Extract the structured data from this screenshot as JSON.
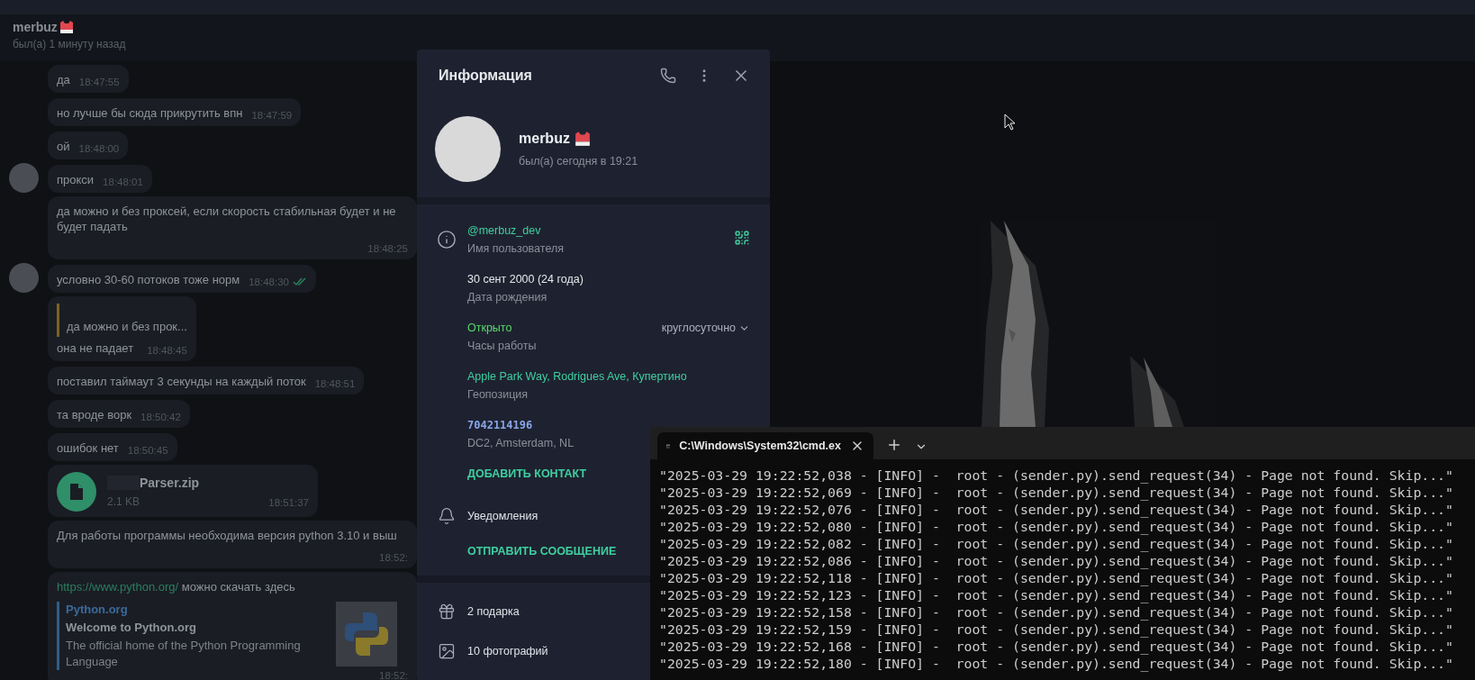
{
  "chat_header": {
    "name": "merbuz",
    "status": "был(а) 1 минуту назад"
  },
  "messages": [
    {
      "kind": "text",
      "text": "да",
      "time": "18:47:55",
      "avatar": false
    },
    {
      "kind": "text",
      "text": "но лучше бы сюда прикрутить впн",
      "time": "18:47:59",
      "avatar": false
    },
    {
      "kind": "text",
      "text": "ой",
      "time": "18:48:00",
      "avatar": false
    },
    {
      "kind": "text",
      "text": "прокси",
      "time": "18:48:01",
      "avatar": true
    },
    {
      "kind": "text",
      "text": "да можно и без проксей, если скорость стабильная будет и не будет падать",
      "time": "18:48:25",
      "avatar": false
    },
    {
      "kind": "text",
      "text": "условно 30-60 потоков тоже норм",
      "time": "18:48:30",
      "avatar": true,
      "read": true
    },
    {
      "kind": "reply",
      "quote": "да можно и без прок...",
      "text": "она не падает",
      "time": "18:48:45",
      "avatar": false
    },
    {
      "kind": "text",
      "text": "поставил таймаут 3 секунды на каждый поток",
      "time": "18:48:51",
      "avatar": false
    },
    {
      "kind": "text",
      "text": "та вроде ворк",
      "time": "18:50:42",
      "avatar": false
    },
    {
      "kind": "text",
      "text": "ошибок нет",
      "time": "18:50:45",
      "avatar": false
    },
    {
      "kind": "file",
      "name": "Parser.zip",
      "size": "2.1 KB",
      "time": "18:51:37",
      "redacted": true,
      "avatar": false
    },
    {
      "kind": "text",
      "text": "Для работы программы необходима версия python 3.10 и выш",
      "time": "18:52:",
      "avatar": false
    },
    {
      "kind": "link",
      "url": "https://www.python.org/",
      "text": "можно скачать здесь",
      "preview": {
        "site": "Python.org",
        "title": "Welcome to Python.org",
        "description": "The official home of the Python Programming Language"
      },
      "time": "18:52:",
      "avatar": false
    }
  ],
  "info_panel": {
    "title": "Информация",
    "name": "merbuz",
    "status": "был(а) сегодня в 19:21",
    "rows": [
      {
        "kind": "username",
        "value": "@merbuz_dev",
        "label": "Имя пользователя"
      },
      {
        "kind": "birthday",
        "value": "30 сент 2000 (24 года)",
        "label": "Дата рождения"
      },
      {
        "kind": "hours",
        "value": "Открыто",
        "extra": "круглосуточно",
        "label": "Часы работы"
      },
      {
        "kind": "location",
        "value": "Apple Park Way, Rodrigues Ave, Купертино",
        "label": "Геопозиция"
      },
      {
        "kind": "phone",
        "value": "7042114196",
        "label": "DC2, Amsterdam, NL"
      }
    ],
    "add_contact": "ДОБАВИТЬ КОНТАКТ",
    "notifications": "Уведомления",
    "send_message": "ОТПРАВИТЬ СООБЩЕНИЕ",
    "media": [
      {
        "kind": "gifts",
        "label": "2 подарка"
      },
      {
        "kind": "photos",
        "label": "10 фотографий"
      }
    ]
  },
  "terminal": {
    "tab_title": "C:\\Windows\\System32\\cmd.ex",
    "lines": [
      "\"2025-03-29 19:22:52,038 - [INFO] -  root - (sender.py).send_request(34) - Page not found. Skip...\"",
      "\"2025-03-29 19:22:52,069 - [INFO] -  root - (sender.py).send_request(34) - Page not found. Skip...\"",
      "\"2025-03-29 19:22:52,076 - [INFO] -  root - (sender.py).send_request(34) - Page not found. Skip...\"",
      "\"2025-03-29 19:22:52,080 - [INFO] -  root - (sender.py).send_request(34) - Page not found. Skip...\"",
      "\"2025-03-29 19:22:52,082 - [INFO] -  root - (sender.py).send_request(34) - Page not found. Skip...\"",
      "\"2025-03-29 19:22:52,086 - [INFO] -  root - (sender.py).send_request(34) - Page not found. Skip...\"",
      "\"2025-03-29 19:22:52,118 - [INFO] -  root - (sender.py).send_request(34) - Page not found. Skip...\"",
      "\"2025-03-29 19:22:52,123 - [INFO] -  root - (sender.py).send_request(34) - Page not found. Skip...\"",
      "\"2025-03-29 19:22:52,158 - [INFO] -  root - (sender.py).send_request(34) - Page not found. Skip...\"",
      "\"2025-03-29 19:22:52,159 - [INFO] -  root - (sender.py).send_request(34) - Page not found. Skip...\"",
      "\"2025-03-29 19:22:52,168 - [INFO] -  root - (sender.py).send_request(34) - Page not found. Skip...\"",
      "\"2025-03-29 19:22:52,180 - [INFO] -  root - (sender.py).send_request(34) - Page not found. Skip...\""
    ]
  }
}
